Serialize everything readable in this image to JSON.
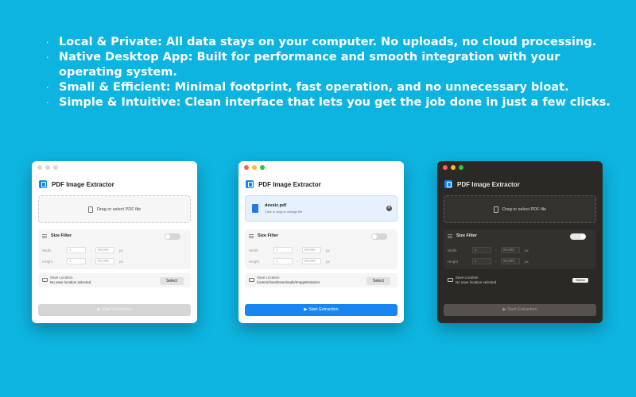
{
  "features": [
    "Local & Private: All data stays on your computer. No uploads, no cloud processing.",
    "Native Desktop App: Built for performance and smooth integration with your operating system.",
    "Small & Efficient: Minimal footprint, fast operation, and no unnecessary bloat.",
    "Simple & Intuitive: Clean interface that lets you get the job done in just a few clicks."
  ],
  "bullet": "·",
  "app": {
    "title": "PDF Image Extractor",
    "dropzone_label": "Drag or select PDF file",
    "size_filter_label": "Size Filter",
    "width_label": "Width",
    "height_label": "Height",
    "min_value": "1",
    "max_placeholder": "99,999",
    "unit": "px",
    "range_sep": "-",
    "save_location_label": "Save Location",
    "no_location": "No save location selected",
    "select_label": "Select",
    "start_label": "▶ Start Extraction",
    "close_glyph": "✕"
  },
  "window2": {
    "file_name": "devsic.pdf",
    "file_hint": "Click or drag to change file",
    "save_path": "/Users/chan/Downloads/ImageExtractor"
  },
  "colors": {
    "background": "#0db4e0",
    "accent": "#1786f0",
    "dark_window": "#2b2926"
  }
}
